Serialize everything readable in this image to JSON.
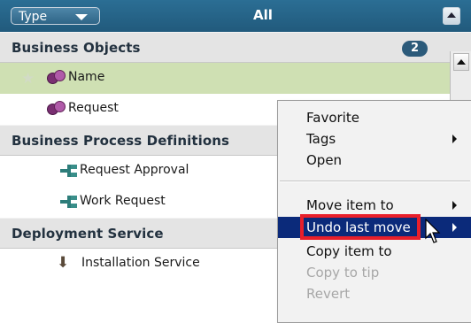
{
  "header": {
    "type_label": "Type",
    "filter_label": "All"
  },
  "groups": [
    {
      "label": "Business Objects",
      "count": "2"
    },
    {
      "label": "Business Process Definitions"
    },
    {
      "label": "Deployment Service"
    }
  ],
  "items": [
    {
      "label": "Name",
      "selected": true,
      "icon": "business-object-icon"
    },
    {
      "label": "Request",
      "icon": "business-object-icon"
    },
    {
      "label": "Request Approval",
      "icon": "process-flow-icon"
    },
    {
      "label": "Work Request",
      "icon": "process-flow-icon"
    },
    {
      "label": "Installation Service",
      "icon": "install-icon"
    }
  ],
  "context_menu": {
    "items": [
      {
        "label": "Favorite"
      },
      {
        "label": "Tags",
        "submenu": true
      },
      {
        "label": "Open"
      },
      {
        "label": "Move item to",
        "submenu": true
      },
      {
        "label": "Undo last move",
        "highlighted": true,
        "submenu": true
      },
      {
        "label": "Copy item to"
      },
      {
        "label": "Copy to tip",
        "disabled": true
      },
      {
        "label": "Revert",
        "disabled": true
      }
    ]
  },
  "colors": {
    "header": "#215a7c",
    "selected_row": "#cfe0b3",
    "menu_highlight": "#0b2a7a",
    "annotation_box": "#e81f2a"
  }
}
